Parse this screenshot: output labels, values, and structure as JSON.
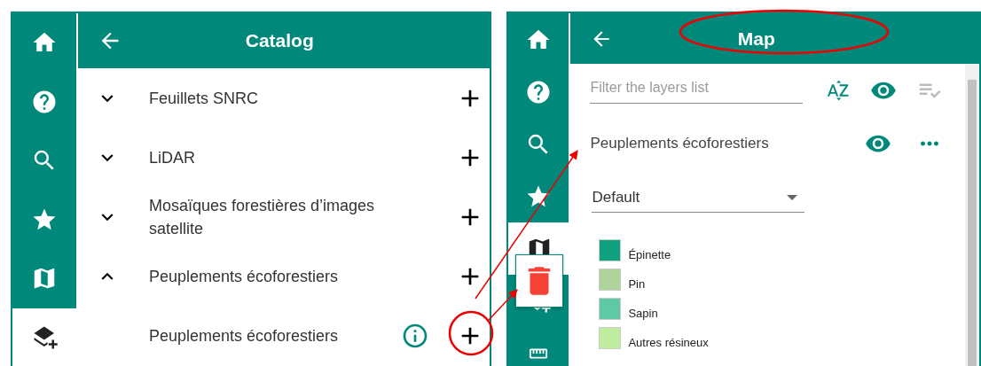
{
  "catalog_panel": {
    "sidebar": [
      {
        "selected": false
      },
      {
        "selected": false
      },
      {
        "selected": false
      },
      {
        "selected": false
      },
      {
        "selected": false
      },
      {
        "selected": true
      }
    ],
    "title": "Catalog",
    "items": [
      {
        "label": "Feuillets SNRC",
        "expanded": false
      },
      {
        "label": "LiDAR",
        "expanded": false
      },
      {
        "label": "Mosaïques forestières d’images satellite",
        "expanded": false
      },
      {
        "label": "Peuplements écoforestiers",
        "expanded": true,
        "children": [
          {
            "label": "Peuplements écoforestiers"
          }
        ]
      }
    ]
  },
  "map_panel": {
    "sidebar": [
      {
        "selected": false
      },
      {
        "selected": false
      },
      {
        "selected": false
      },
      {
        "selected": false
      },
      {
        "selected": true
      },
      {
        "selected": false
      },
      {
        "selected": false
      }
    ],
    "title": "Map",
    "filter": {
      "placeholder": "Filter the layers list"
    },
    "layer": {
      "name": "Peuplements écoforestiers",
      "style": "Default",
      "legend": [
        {
          "label": "Épinette",
          "color": "#0fa07f"
        },
        {
          "label": "Pin",
          "color": "#aed49b"
        },
        {
          "label": "Sapin",
          "color": "#5ec9a4"
        },
        {
          "label": "Autres résineux",
          "color": "#c1eda1"
        }
      ]
    }
  }
}
